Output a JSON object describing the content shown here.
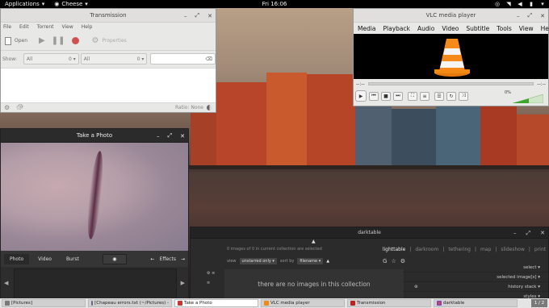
{
  "topbar": {
    "applications": "Applications",
    "active_app": "Cheese",
    "clock": "Fri 16:06"
  },
  "transmission": {
    "title": "Transmission",
    "menu": [
      "File",
      "Edit",
      "Torrent",
      "View",
      "Help"
    ],
    "toolbar": {
      "open": "Open",
      "properties": "Properties"
    },
    "filter": {
      "show_label": "Show:",
      "all1": "All",
      "count1": "0",
      "all2": "All",
      "count2": "0"
    },
    "status": {
      "ratio": "Ratio: None"
    }
  },
  "vlc": {
    "title": "VLC media player",
    "menu": [
      "Media",
      "Playback",
      "Audio",
      "Video",
      "Subtitle",
      "Tools",
      "View",
      "Help"
    ],
    "time_left": "--:--",
    "time_right": "--:--",
    "volume": "0%"
  },
  "photo": {
    "title": "Take a Photo",
    "tabs": [
      "Photo",
      "Video",
      "Burst"
    ],
    "effects": "Effects"
  },
  "darktable": {
    "title": "darktable",
    "info": "0 images of 0 in current collection are selected",
    "view_label": "view",
    "view_value": "unstarred only",
    "sort_label": "sort by",
    "sort_value": "filename",
    "modes": [
      "lighttable",
      "|",
      "darkroom",
      "|",
      "tethering",
      "|",
      "map",
      "|",
      "slideshow",
      "|",
      "print"
    ],
    "empty": "there are no images in this collection",
    "right_panel": [
      "select",
      "selected image[s]",
      "history stack",
      "styles"
    ]
  },
  "taskbar": {
    "items": [
      "[Pictures]",
      "[Chapeau errors.txt (~/Pictures) -",
      "Take a Photo",
      "VLC media player",
      "Transmission",
      "darktable"
    ],
    "pager": "1 / 2"
  }
}
